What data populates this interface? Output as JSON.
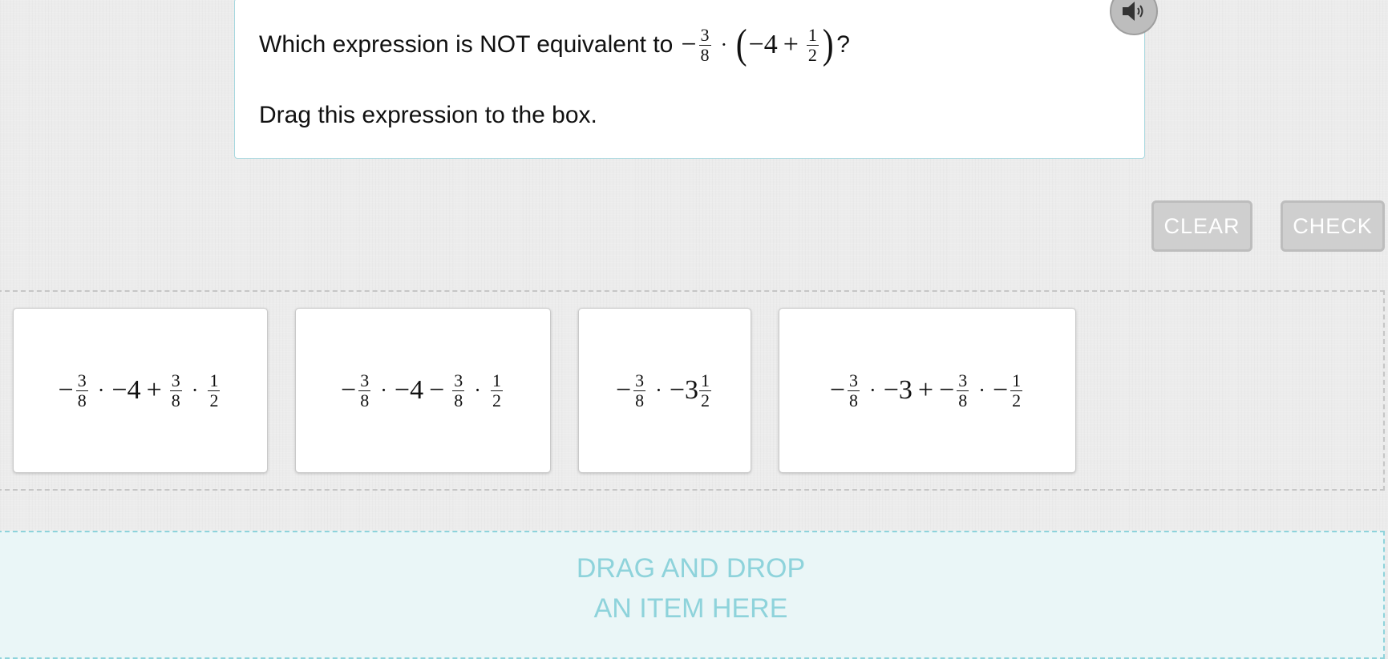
{
  "question": {
    "prompt_text": "Which expression is NOT equivalent to",
    "expression": {
      "neg": "−",
      "frac1": {
        "num": "3",
        "den": "8"
      },
      "dot": "·",
      "lparen": "(",
      "inner": "−4",
      "plus": "+",
      "frac2": {
        "num": "1",
        "den": "2"
      },
      "rparen": ")"
    },
    "question_mark": "?",
    "instruction": "Drag this expression to the box."
  },
  "audio": {
    "icon": "speaker-icon"
  },
  "buttons": {
    "clear": "CLEAR",
    "check": "CHECK"
  },
  "tiles": [
    {
      "t1": "−",
      "f1": {
        "num": "3",
        "den": "8"
      },
      "d1": "·",
      "t2": "−4",
      "op": "+",
      "f2": {
        "num": "3",
        "den": "8"
      },
      "d2": "·",
      "f3": {
        "num": "1",
        "den": "2"
      }
    },
    {
      "t1": "−",
      "f1": {
        "num": "3",
        "den": "8"
      },
      "d1": "·",
      "t2": "−4",
      "op": "−",
      "f2": {
        "num": "3",
        "den": "8"
      },
      "d2": "·",
      "f3": {
        "num": "1",
        "den": "2"
      }
    },
    {
      "t1": "−",
      "f1": {
        "num": "3",
        "den": "8"
      },
      "d1": "·",
      "t2": "−3",
      "f2": {
        "num": "1",
        "den": "2"
      }
    },
    {
      "t1": "−",
      "f1": {
        "num": "3",
        "den": "8"
      },
      "d1": "·",
      "t2": "−3",
      "op": "+",
      "t3": "−",
      "f2": {
        "num": "3",
        "den": "8"
      },
      "d2": "·",
      "t4": "−",
      "f3": {
        "num": "1",
        "den": "2"
      }
    }
  ],
  "dropzone": {
    "line1": "DRAG AND DROP",
    "line2": "AN ITEM HERE"
  }
}
